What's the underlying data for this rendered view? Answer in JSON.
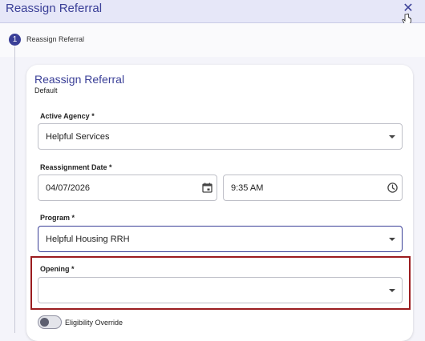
{
  "header": {
    "title": "Reassign Referral"
  },
  "stepper": {
    "step_number": "1",
    "step_label": "Reassign Referral"
  },
  "card": {
    "title": "Reassign Referral",
    "subtitle": "Default"
  },
  "form": {
    "agency": {
      "label": "Active Agency *",
      "value": "Helpful Services"
    },
    "reassignment": {
      "label": "Reassignment Date *",
      "date": "04/07/2026",
      "time": "9:35 AM"
    },
    "program": {
      "label": "Program *",
      "value": "Helpful Housing RRH"
    },
    "opening": {
      "label": "Opening *",
      "value": ""
    },
    "eligibility": {
      "label": "Eligibility Override",
      "enabled": false
    }
  },
  "colors": {
    "accent": "#3a3f97",
    "highlight": "#9b1c1f",
    "header_bg": "#e6e7f8"
  },
  "icons": {
    "close": "close-icon",
    "calendar": "calendar-icon",
    "clock": "clock-icon",
    "dropdown": "chevron-down-icon"
  }
}
